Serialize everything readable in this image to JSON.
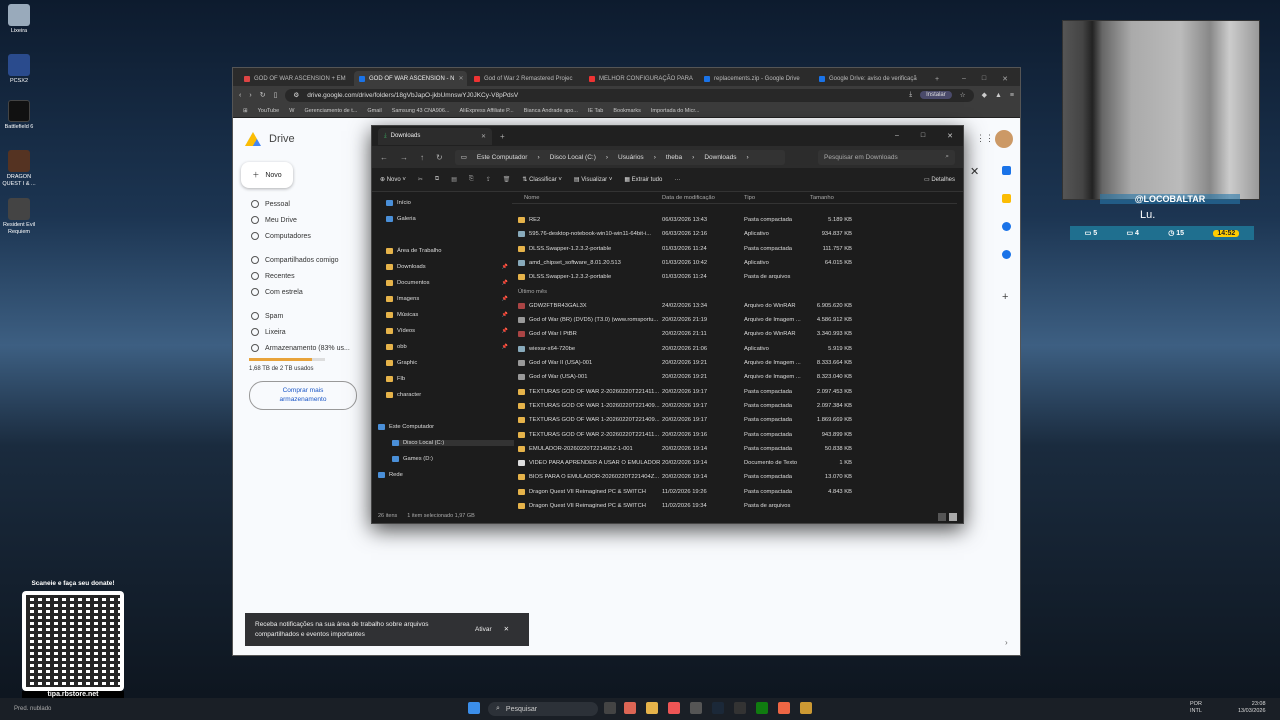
{
  "desktop": {
    "icons": [
      {
        "label": "Lixeira"
      },
      {
        "label": "PCSX2"
      },
      {
        "label": "Battlefield 6"
      },
      {
        "label": "DRAGON QUEST I & ..."
      },
      {
        "label": "Resident Evil Requiem"
      }
    ]
  },
  "browser": {
    "tabs": [
      {
        "label": "GOD OF WAR ASCENSION + EM"
      },
      {
        "label": "GOD OF WAR ASCENSION - N"
      },
      {
        "label": "God of War 2 Remastered Projec"
      },
      {
        "label": "MELHOR CONFIGURAÇÃO PARA"
      },
      {
        "label": "replacements.zip - Google Drive"
      },
      {
        "label": "Google Drive: aviso de verificaçã"
      }
    ],
    "url": "drive.google.com/drive/folders/18gVbJapO-jkbUmnswYJ0JKCy-V8pPdsV",
    "install_label": "Instalar",
    "bookmarks": [
      "YouTube",
      "",
      "Gerenciamento de t...",
      "Gmail",
      "Samsung 43 CNA906...",
      "",
      "AliExpress Affiliate P...",
      "Bianca Andrade apo...",
      "IE Tab",
      "Bookmarks",
      "Importada do Micr..."
    ]
  },
  "drive": {
    "logo_text": "Drive",
    "new_label": "Novo",
    "nav": [
      {
        "label": "Pessoal"
      },
      {
        "label": "Meu Drive"
      },
      {
        "label": "Computadores"
      },
      {
        "label": "Compartilhados comigo"
      },
      {
        "label": "Recentes"
      },
      {
        "label": "Com estrela"
      },
      {
        "label": "Spam"
      },
      {
        "label": "Lixeira"
      },
      {
        "label": "Armazenamento (83% us..."
      }
    ],
    "storage_text": "1,68 TB de 2 TB usados",
    "storage_fraction": 0.83,
    "buy_more": "Comprar mais armazenamento",
    "toast_text": "Receba notificações na sua área de trabalho sobre arquivos compartilhados e eventos importantes",
    "toast_action": "Ativar"
  },
  "explorer": {
    "tab_title": "Downloads",
    "breadcrumb": [
      "Este Computador",
      "Disco Local (C:)",
      "Usuários",
      "theba",
      "Downloads"
    ],
    "search_placeholder": "Pesquisar em Downloads",
    "toolbar": {
      "new": "Novo",
      "sort": "Classificar",
      "view": "Visualizar",
      "extract": "Extrair tudo",
      "more": "···",
      "details": "Detalhes"
    },
    "tree": [
      {
        "label": "Início"
      },
      {
        "label": "Galeria"
      },
      {
        "label": "Área de Trabalho"
      },
      {
        "label": "Downloads"
      },
      {
        "label": "Documentos"
      },
      {
        "label": "Imagens"
      },
      {
        "label": "Músicas"
      },
      {
        "label": "Vídeos"
      },
      {
        "label": "obb"
      },
      {
        "label": "Graphic"
      },
      {
        "label": "Flb"
      },
      {
        "label": "character"
      },
      {
        "label": "Este Computador"
      },
      {
        "label": "Disco Local (C:)"
      },
      {
        "label": "Games (D:)"
      },
      {
        "label": "Rede"
      }
    ],
    "columns": {
      "name": "Nome",
      "date": "Data de modificação",
      "type": "Tipo",
      "size": "Tamanho"
    },
    "rows": [
      {
        "name": "RE2",
        "date": "06/03/2026 13:43",
        "type": "Pasta compactada",
        "size": "5.189 KB"
      },
      {
        "name": "595.76-desktop-notebook-win10-win11-64bit-i...",
        "date": "06/03/2026 12:16",
        "type": "Aplicativo",
        "size": "934.837 KB"
      },
      {
        "name": "DLSS.Swapper-1.2.3.2-portable",
        "date": "01/03/2026 11:24",
        "type": "Pasta compactada",
        "size": "111.757 KB"
      },
      {
        "name": "amd_chipset_software_8.01.20.513",
        "date": "01/03/2026 10:42",
        "type": "Aplicativo",
        "size": "64.015 KB"
      },
      {
        "name": "DLSS.Swapper-1.2.3.2-portable",
        "date": "01/03/2026 11:24",
        "type": "Pasta de arquivos",
        "size": ""
      },
      {
        "name": "Último mês",
        "date": "",
        "type": "",
        "size": ""
      },
      {
        "name": "GDW2FTBR43GAL3X",
        "date": "24/02/2026 13:34",
        "type": "Arquivo do WinRAR",
        "size": "6.905.620 KB"
      },
      {
        "name": "God of War (BR) (DVD5) (T3.0) (www.romsportu...",
        "date": "20/02/2026 21:19",
        "type": "Arquivo de Imagem ...",
        "size": "4.586.912 KB"
      },
      {
        "name": "God of War I PtBR",
        "date": "20/02/2026 21:11",
        "type": "Arquivo do WinRAR",
        "size": "3.340.993 KB"
      },
      {
        "name": "wiexar-x64-720be",
        "date": "20/02/2026 21:06",
        "type": "Aplicativo",
        "size": "5.919 KB"
      },
      {
        "name": "God of War II (USA)-001",
        "date": "20/02/2026 19:21",
        "type": "Arquivo de Imagem ...",
        "size": "8.333.664 KB"
      },
      {
        "name": "God of War (USA)-001",
        "date": "20/02/2026 19:21",
        "type": "Arquivo de Imagem ...",
        "size": "8.323.040 KB"
      },
      {
        "name": "TEXTURAS GOD OF WAR 2-20260220T221411...",
        "date": "20/02/2026 19:17",
        "type": "Pasta compactada",
        "size": "2.097.453 KB"
      },
      {
        "name": "TEXTURAS GOD OF WAR 1-20260220T221409...",
        "date": "20/02/2026 19:17",
        "type": "Pasta compactada",
        "size": "2.097.384 KB"
      },
      {
        "name": "TEXTURAS GOD OF WAR 1-20260220T221409...",
        "date": "20/02/2026 19:17",
        "type": "Pasta compactada",
        "size": "1.869.669 KB"
      },
      {
        "name": "TEXTURAS GOD OF WAR 2-20260220T221411...",
        "date": "20/02/2026 19:16",
        "type": "Pasta compactada",
        "size": "943.899 KB"
      },
      {
        "name": "EMULADOR-20260220T221405Z-1-001",
        "date": "20/02/2026 19:14",
        "type": "Pasta compactada",
        "size": "50.838 KB"
      },
      {
        "name": "VIDEO PARA APRENDER A USAR O EMULADOR",
        "date": "20/02/2026 19:14",
        "type": "Documento de Texto",
        "size": "1 KB"
      },
      {
        "name": "BIOS PARA O EMULADOR-20260220T221404Z...",
        "date": "20/02/2026 19:14",
        "type": "Pasta compactada",
        "size": "13.070 KB"
      },
      {
        "name": "Dragon Quest VII Reimagined PC & SWITCH",
        "date": "11/02/2026 19:26",
        "type": "Pasta compactada",
        "size": "4.843 KB"
      },
      {
        "name": "Dragon Quest VII Reimagined PC & SWITCH",
        "date": "11/02/2026 19:34",
        "type": "Pasta de arquivos",
        "size": ""
      }
    ],
    "status": [
      "26 itens",
      "1 item selecionado 1,97 GB"
    ]
  },
  "stream": {
    "username": "@LOCOBALTAR",
    "name": "Lu.",
    "stats": [
      "5",
      "4",
      "15"
    ],
    "clock": "14:52",
    "qr_caption": "Scaneie e faça seu donate!",
    "qr_url": "tipa.rbstore.net"
  },
  "taskbar": {
    "search": "Pesquisar",
    "weather": "Pred. nublado",
    "lang1": "POR",
    "lang2": "INTL",
    "time": "23:08",
    "date": "13/03/2026"
  }
}
